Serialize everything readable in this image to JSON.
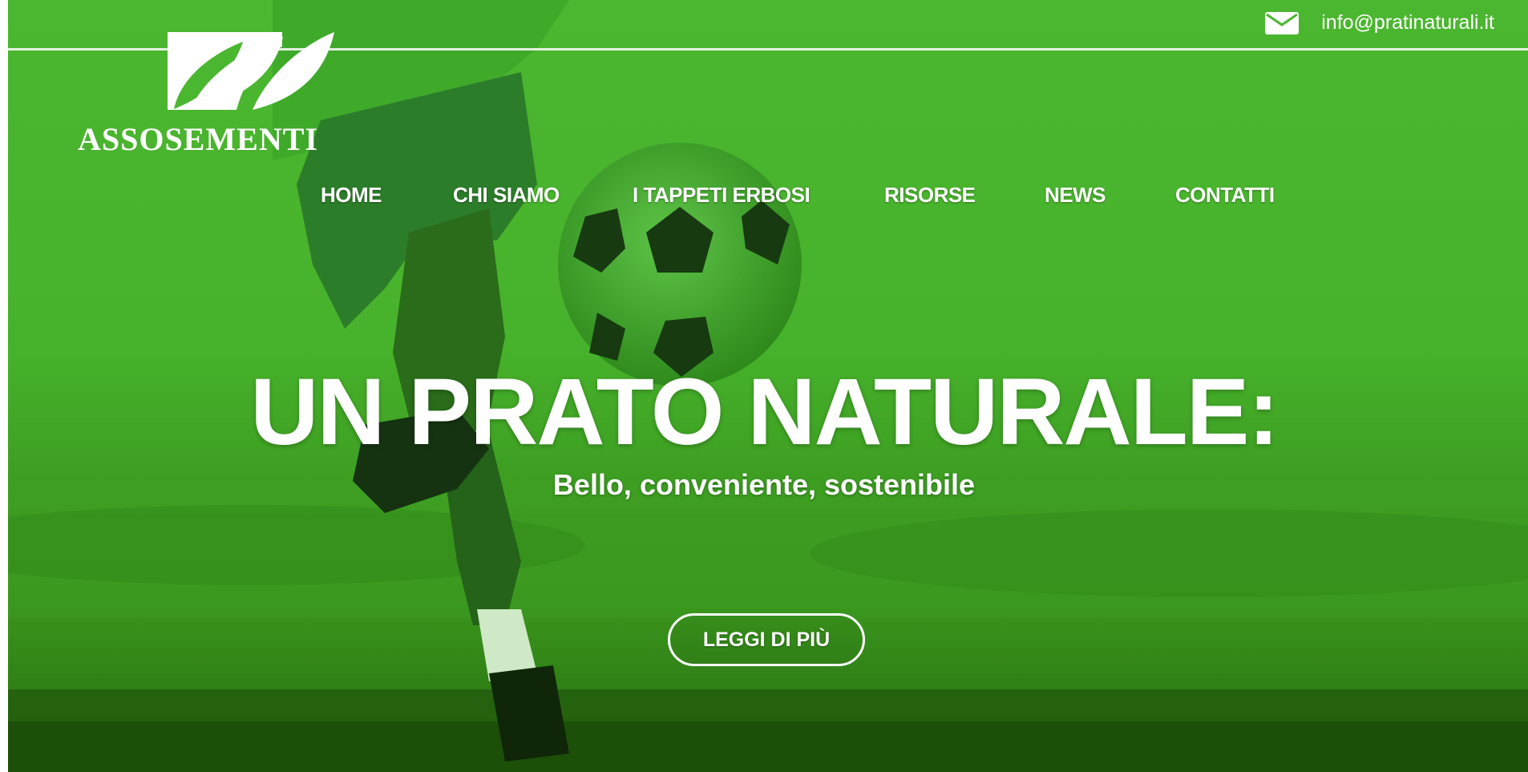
{
  "header": {
    "email": "info@pratinaturali.it",
    "logo_text": "ASSOSEMENTI"
  },
  "nav": {
    "items": [
      {
        "label": "HOME"
      },
      {
        "label": "CHI SIAMO"
      },
      {
        "label": "I TAPPETI ERBOSI"
      },
      {
        "label": "RISORSE"
      },
      {
        "label": "NEWS"
      },
      {
        "label": "CONTATTI"
      }
    ]
  },
  "hero": {
    "title": "UN PRATO NATURALE:",
    "subtitle": "Bello, conveniente, sostenibile",
    "cta_label": "LEGGI DI PIÙ"
  },
  "icons": {
    "email": "envelope-icon",
    "logo": "leaves-logo-icon"
  },
  "colors": {
    "overlay_green": "#4bb62f",
    "text": "#ffffff"
  }
}
